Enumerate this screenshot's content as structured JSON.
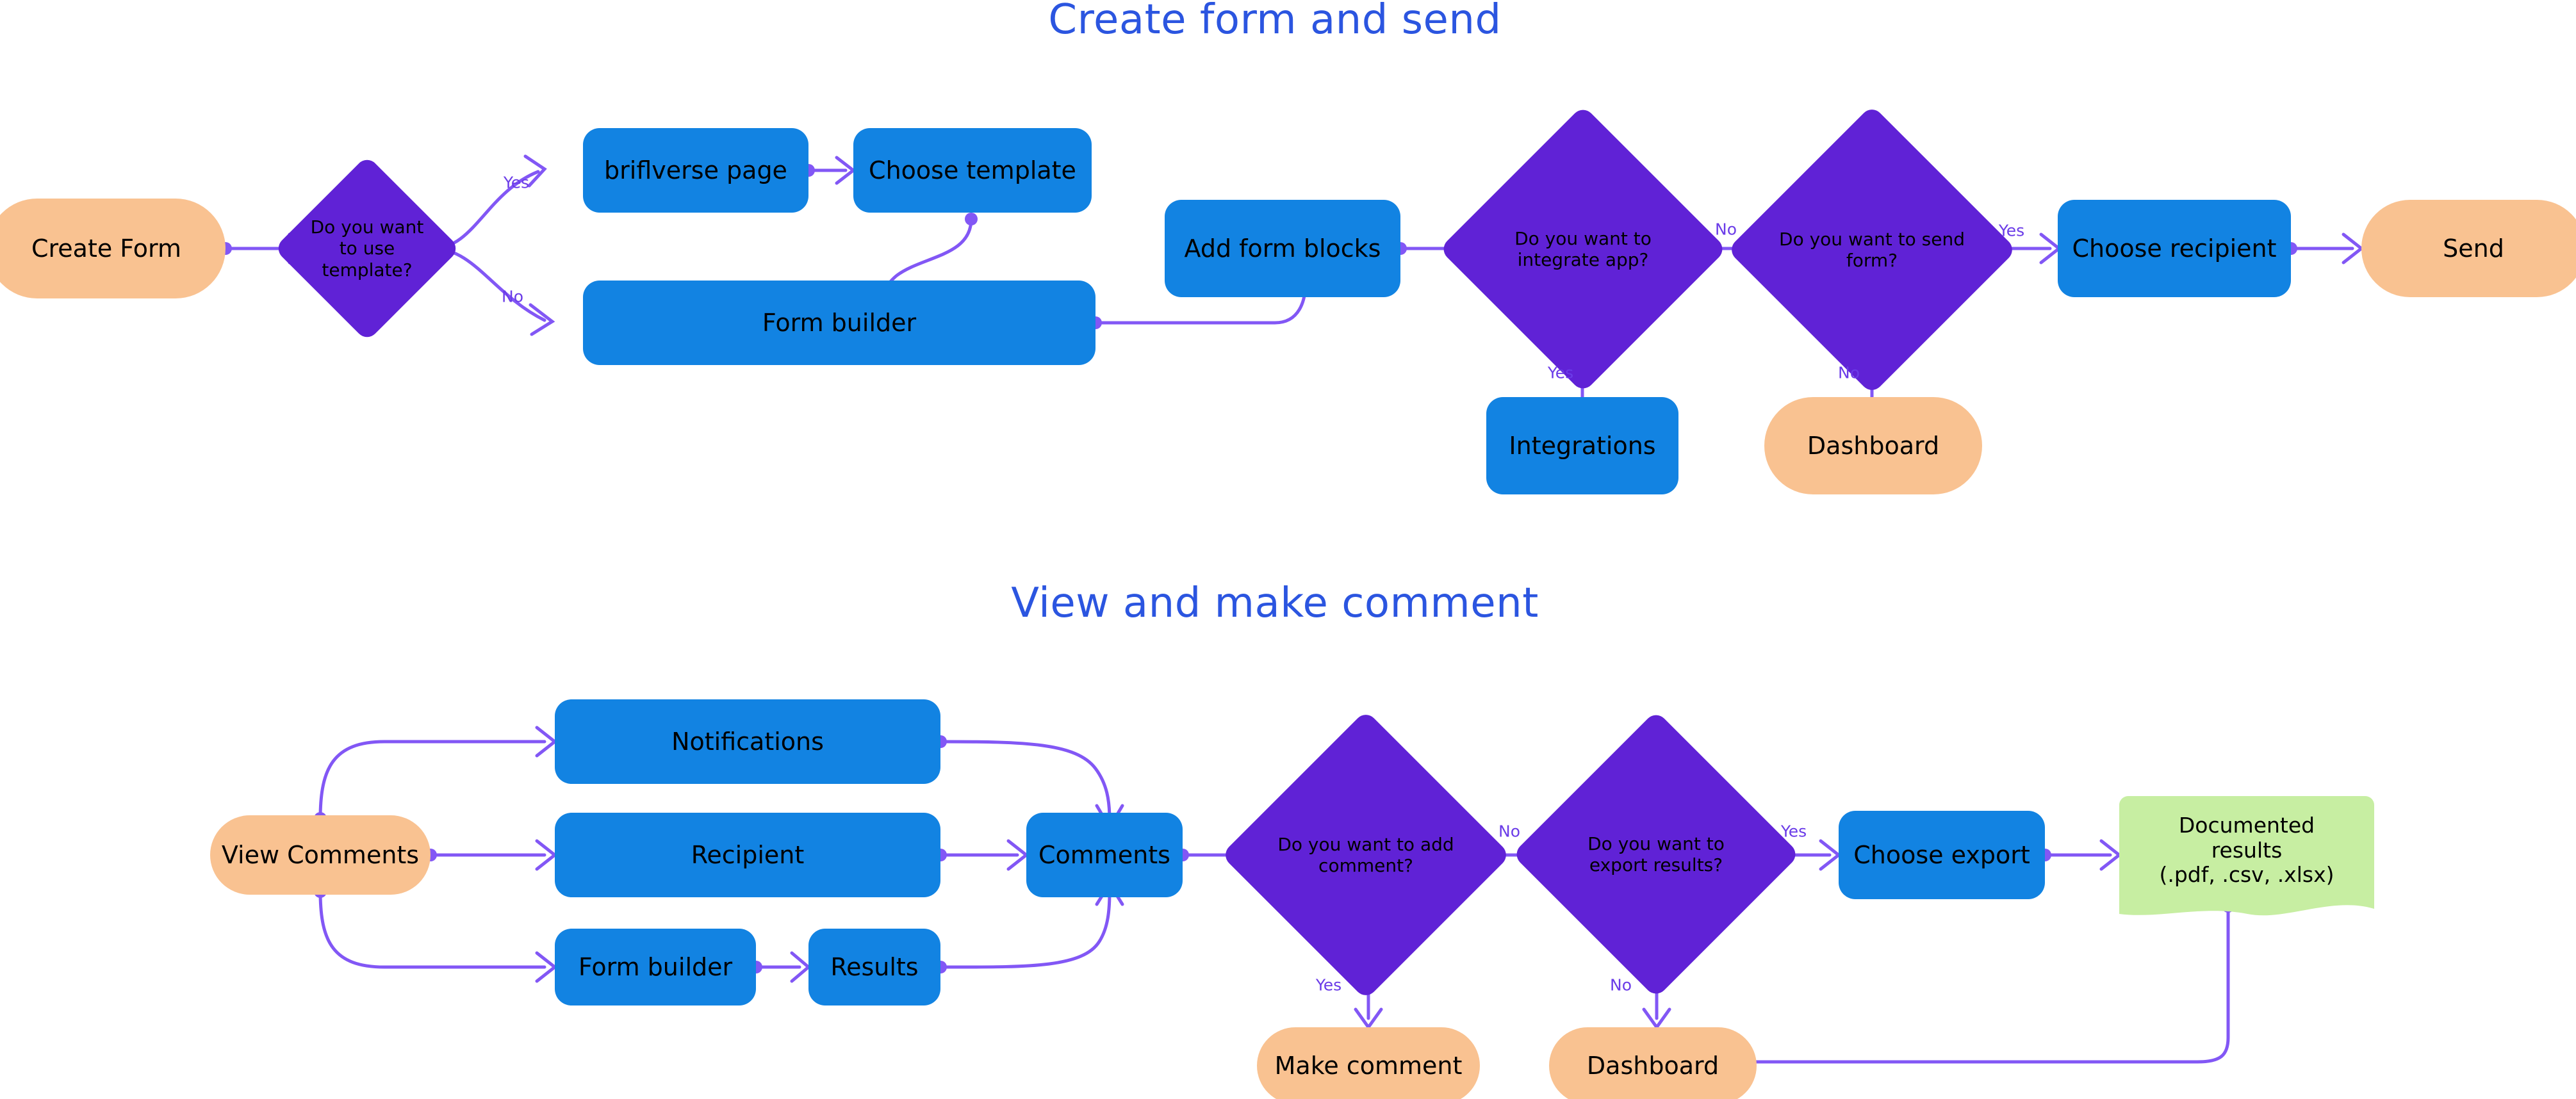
{
  "colors": {
    "process": "#1283e2",
    "terminal": "#f9c291",
    "decision": "#6022d6",
    "document": "#c7eea2",
    "edge": "#8257f5",
    "title": "#2b55e0",
    "label_text": "#6b3ce8",
    "background": "#ffffff"
  },
  "sections": [
    {
      "title": "Create form and send"
    },
    {
      "title": "View and make comment"
    }
  ],
  "section1": {
    "nodes": {
      "create_form": "Create Form",
      "use_template": "Do you want to use template?",
      "briflverse_page": "briflverse page",
      "choose_template": "Choose template",
      "form_builder": "Form builder",
      "add_form_blocks": "Add form blocks",
      "integrate_app": "Do you want to integrate app?",
      "integrations": "Integrations",
      "send_form": "Do you want to send form?",
      "dashboard": "Dashboard",
      "choose_recipient": "Choose recipient",
      "send": "Send"
    },
    "edge_labels": {
      "template_yes": "Yes",
      "template_no": "No",
      "integrate_yes": "Yes",
      "integrate_no": "No",
      "send_yes": "Yes",
      "send_no": "No"
    }
  },
  "section2": {
    "nodes": {
      "view_comments": "View Comments",
      "notifications": "Notifications",
      "recipient": "Recipient",
      "form_builder": "Form builder",
      "results": "Results",
      "comments": "Comments",
      "add_comment": "Do you want to add comment?",
      "export_results": "Do you want to export results?",
      "make_comment": "Make comment",
      "dashboard": "Dashboard",
      "choose_export": "Choose export",
      "documented_results": "Documented results (.pdf, .csv, .xlsx)",
      "documented_results_line1": "Documented",
      "documented_results_line2": "results",
      "documented_results_line3": "(.pdf, .csv, .xlsx)"
    },
    "edge_labels": {
      "add_comment_yes": "Yes",
      "add_comment_no": "No",
      "export_yes": "Yes",
      "export_no": "No"
    }
  }
}
